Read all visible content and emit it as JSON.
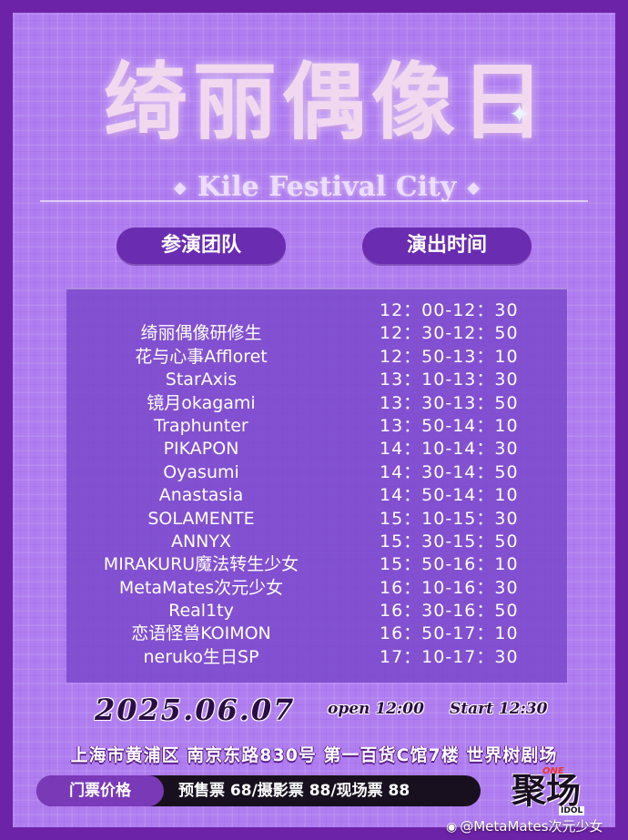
{
  "title": "绮丽偶像日",
  "subtitle": "Kile Festival City",
  "headers": {
    "team": "参演团队",
    "time": "演出时间"
  },
  "schedule": [
    {
      "team": "",
      "time": "12：00-12：30"
    },
    {
      "team": "绮丽偶像研修生",
      "time": "12：30-12：50"
    },
    {
      "team": "花与心事Affloret",
      "time": "12：50-13：10"
    },
    {
      "team": "StarAxis",
      "time": "13：10-13：30"
    },
    {
      "team": "镜月okagami",
      "time": "13：30-13：50"
    },
    {
      "team": "Traphunter",
      "time": "13：50-14：10"
    },
    {
      "team": "PIKAPON",
      "time": "14：10-14：30"
    },
    {
      "team": "Oyasumi",
      "time": "14：30-14：50"
    },
    {
      "team": "Anastasia",
      "time": "14：50-14：10"
    },
    {
      "team": "SOLAMENTE",
      "time": "15：10-15：30"
    },
    {
      "team": "ANNYX",
      "time": "15：30-15：50"
    },
    {
      "team": "MIRAKURU魔法转生少女",
      "time": "15：50-16：10"
    },
    {
      "team": "MetaMates次元少女",
      "time": "16：10-16：30"
    },
    {
      "team": "Real1ty",
      "time": "16：30-16：50"
    },
    {
      "team": "恋语怪兽KOIMON",
      "time": "16：50-17：10"
    },
    {
      "team": "neruko生日SP",
      "time": "17：10-17：30"
    }
  ],
  "date": "2025.06.07",
  "open": "open 12:00",
  "start": "Start 12:30",
  "address": "上海市黄浦区 南京东路830号 第一百货C馆7楼 世界树剧场",
  "ticket": {
    "label": "门票价格",
    "prices": "预售票 68/摄影票 88/现场票 88"
  },
  "logo": {
    "main": "聚场",
    "one": "ONE",
    "idol": "IDOL"
  },
  "watermark": "@MetaMates次元少女",
  "colors": {
    "frame": "#6d23a8",
    "background": "#b07ef0",
    "panel": "#7846c8",
    "pill": "#6a2cb0"
  }
}
